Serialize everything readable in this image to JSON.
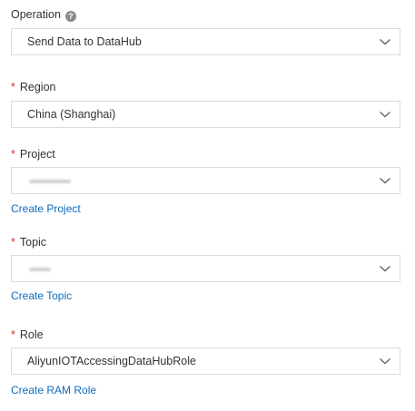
{
  "operation": {
    "label": "Operation",
    "help_icon": "question-mark-icon",
    "value": "Send Data to DataHub"
  },
  "region": {
    "required_mark": "*",
    "label": "Region",
    "value": "China (Shanghai)"
  },
  "project": {
    "required_mark": "*",
    "label": "Project",
    "value": "",
    "create_link": "Create Project"
  },
  "topic": {
    "required_mark": "*",
    "label": "Topic",
    "value": "",
    "create_link": "Create Topic"
  },
  "role": {
    "required_mark": "*",
    "label": "Role",
    "value": "AliyunIOTAccessingDataHubRole",
    "create_link": "Create RAM Role"
  },
  "colors": {
    "required": "#d93026",
    "link": "#0b6bbf",
    "border": "#dcdcdc"
  }
}
